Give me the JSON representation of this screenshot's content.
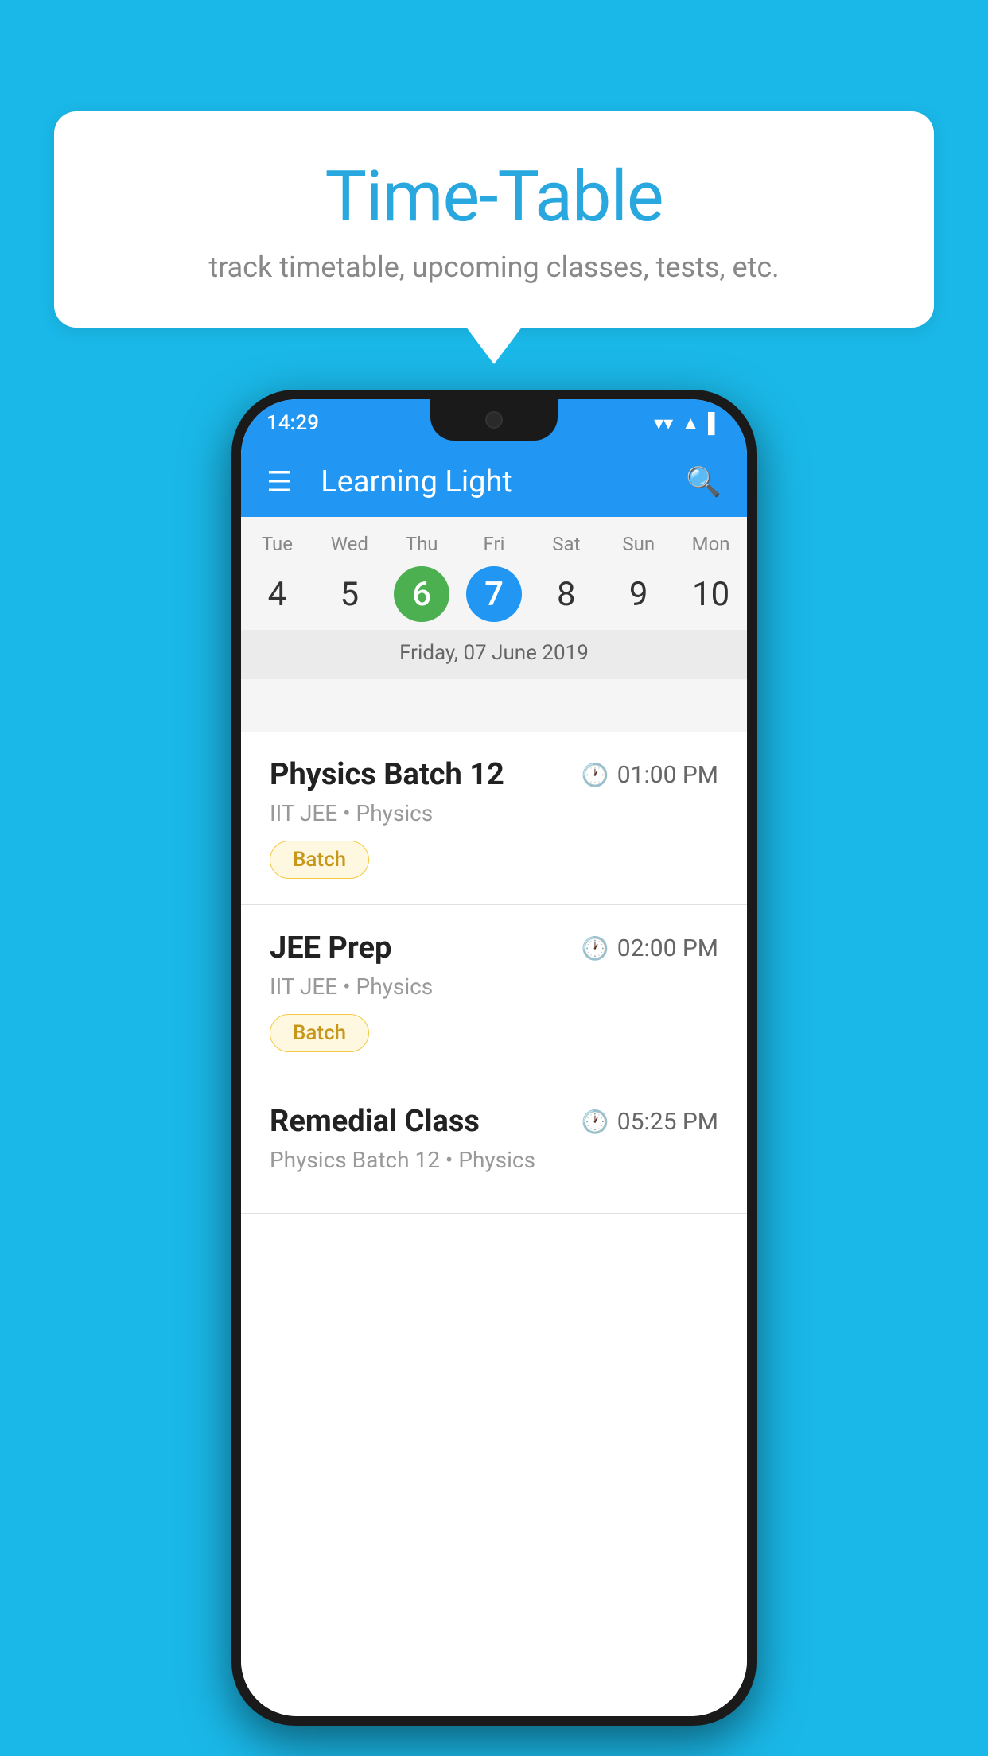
{
  "background_color": "#1ab8e8",
  "speech_bubble": {
    "title": "Time-Table",
    "subtitle": "track timetable, upcoming classes, tests, etc."
  },
  "phone": {
    "status_bar": {
      "time": "14:29"
    },
    "app_bar": {
      "title": "Learning Light"
    },
    "calendar": {
      "days": [
        {
          "label": "Tue",
          "number": "4",
          "state": "normal"
        },
        {
          "label": "Wed",
          "number": "5",
          "state": "normal"
        },
        {
          "label": "Thu",
          "number": "6",
          "state": "today"
        },
        {
          "label": "Fri",
          "number": "7",
          "state": "selected"
        },
        {
          "label": "Sat",
          "number": "8",
          "state": "normal"
        },
        {
          "label": "Sun",
          "number": "9",
          "state": "normal"
        },
        {
          "label": "Mon",
          "number": "10",
          "state": "normal"
        }
      ],
      "selected_date_label": "Friday, 07 June 2019"
    },
    "schedule": [
      {
        "name": "Physics Batch 12",
        "time": "01:00 PM",
        "meta": "IIT JEE • Physics",
        "badge": "Batch"
      },
      {
        "name": "JEE Prep",
        "time": "02:00 PM",
        "meta": "IIT JEE • Physics",
        "badge": "Batch"
      },
      {
        "name": "Remedial Class",
        "time": "05:25 PM",
        "meta": "Physics Batch 12 • Physics",
        "badge": null
      }
    ]
  }
}
